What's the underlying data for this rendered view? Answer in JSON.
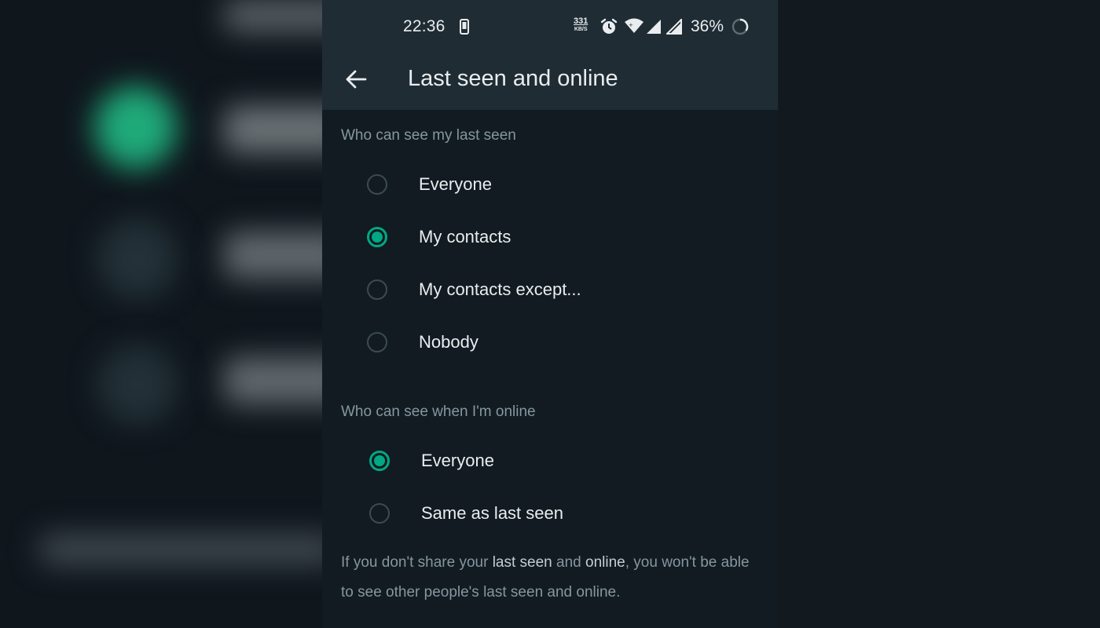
{
  "status_bar": {
    "time": "22:36",
    "net_speed_value": "331",
    "net_speed_unit": "KB/S",
    "battery": "36%"
  },
  "header": {
    "title": "Last seen and online"
  },
  "last_seen": {
    "heading": "Who can see my last seen",
    "options": [
      {
        "label": "Everyone",
        "selected": false
      },
      {
        "label": "My contacts",
        "selected": true
      },
      {
        "label": "My contacts except...",
        "selected": false
      },
      {
        "label": "Nobody",
        "selected": false
      }
    ]
  },
  "online": {
    "heading": "Who can see when I'm online",
    "options": [
      {
        "label": "Everyone",
        "selected": true
      },
      {
        "label": "Same as last seen",
        "selected": false
      }
    ]
  },
  "footnote": {
    "part1": "If you don't share your ",
    "bold1": "last seen",
    "part2": " and ",
    "bold2": "online",
    "part3": ", you won't be able to see other people's last seen and online."
  },
  "colors": {
    "accent": "#00a884",
    "background": "#111b21",
    "app_bar": "#1f2c33",
    "secondary_text": "#8696a0"
  },
  "icons": [
    "arrow-left-icon",
    "phone-icon",
    "alarm-icon",
    "wifi-icon",
    "signal-icon",
    "battery-icon"
  ]
}
